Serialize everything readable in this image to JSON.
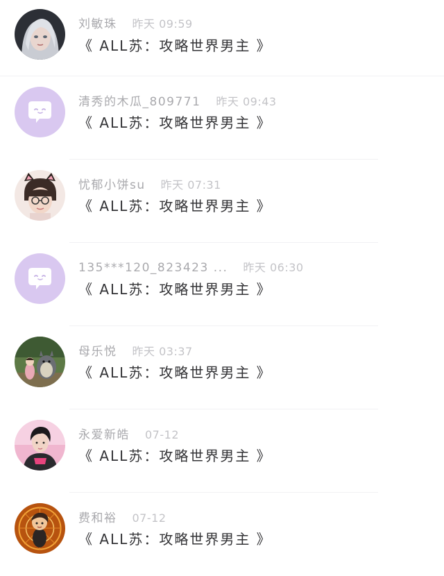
{
  "messages": [
    {
      "name": "刘敏珠",
      "time": "昨天 09:59",
      "title": "《 ALL苏：攻略世界男主 》",
      "avatar": "photo-avatar-silver-hair"
    },
    {
      "name": "清秀的木瓜_809771",
      "time": "昨天 09:43",
      "title": "《 ALL苏：攻略世界男主 》",
      "avatar": "default-chat-bubble-avatar"
    },
    {
      "name": "忧郁小饼su",
      "time": "昨天 07:31",
      "title": "《 ALL苏：攻略世界男主 》",
      "avatar": "photo-avatar-glasses-cat-ears"
    },
    {
      "name": "135***120_823423 ...",
      "time": "昨天 06:30",
      "title": "《 ALL苏：攻略世界男主 》",
      "avatar": "default-chat-bubble-avatar"
    },
    {
      "name": "母乐悦",
      "time": "昨天 03:37",
      "title": "《 ALL苏：攻略世界男主 》",
      "avatar": "photo-avatar-totoro-scene"
    },
    {
      "name": "永爱新皓",
      "time": "07-12",
      "title": "《 ALL苏：攻略世界男主 》",
      "avatar": "photo-avatar-pink-portrait"
    },
    {
      "name": "费和裕",
      "time": "07-12",
      "title": "《 ALL苏：攻略世界男主 》",
      "avatar": "photo-avatar-orange-cartoon"
    }
  ],
  "colors": {
    "default_avatar_bg": "#d9c8f0",
    "name_text": "#a9a9ad",
    "time_text": "#c3c3c7",
    "title_text": "#333336",
    "divider": "#f1f1f3"
  }
}
